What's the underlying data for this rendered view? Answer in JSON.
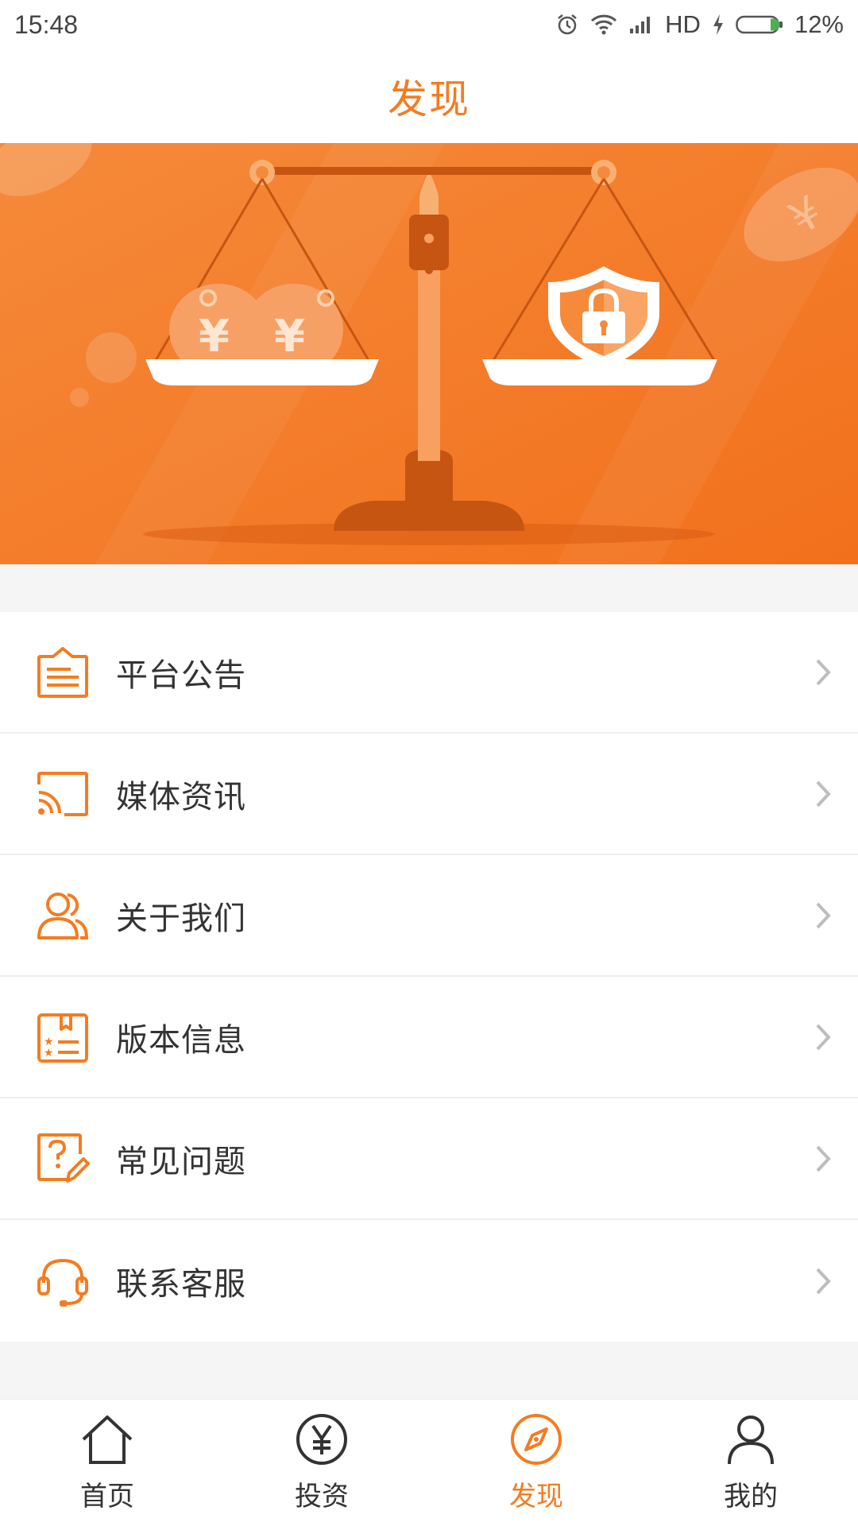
{
  "status_bar": {
    "time": "15:48",
    "network": "HD",
    "battery": "12%",
    "icons": [
      "alarm-icon",
      "wifi-icon",
      "signal-icon",
      "charging-icon",
      "battery-icon"
    ]
  },
  "header": {
    "title": "发现"
  },
  "banner": {
    "icon": "scale-banner-illustration",
    "coin_symbol": "¥"
  },
  "menu": {
    "items": [
      {
        "label": "平台公告",
        "icon": "announcement-icon"
      },
      {
        "label": "媒体资讯",
        "icon": "media-cast-icon"
      },
      {
        "label": "关于我们",
        "icon": "users-icon"
      },
      {
        "label": "版本信息",
        "icon": "version-info-icon"
      },
      {
        "label": "常见问题",
        "icon": "faq-icon"
      },
      {
        "label": "联系客服",
        "icon": "headset-icon"
      }
    ]
  },
  "tab_bar": {
    "active_color": "#f47c20",
    "tabs": [
      {
        "label": "首页",
        "icon": "home-icon",
        "active": false
      },
      {
        "label": "投资",
        "icon": "yen-circle-icon",
        "active": false
      },
      {
        "label": "发现",
        "icon": "compass-icon",
        "active": true
      },
      {
        "label": "我的",
        "icon": "person-icon",
        "active": false
      }
    ]
  },
  "colors": {
    "accent": "#f47c20",
    "banner_bg": "#f27a24",
    "page_bg": "#f5f5f5"
  }
}
